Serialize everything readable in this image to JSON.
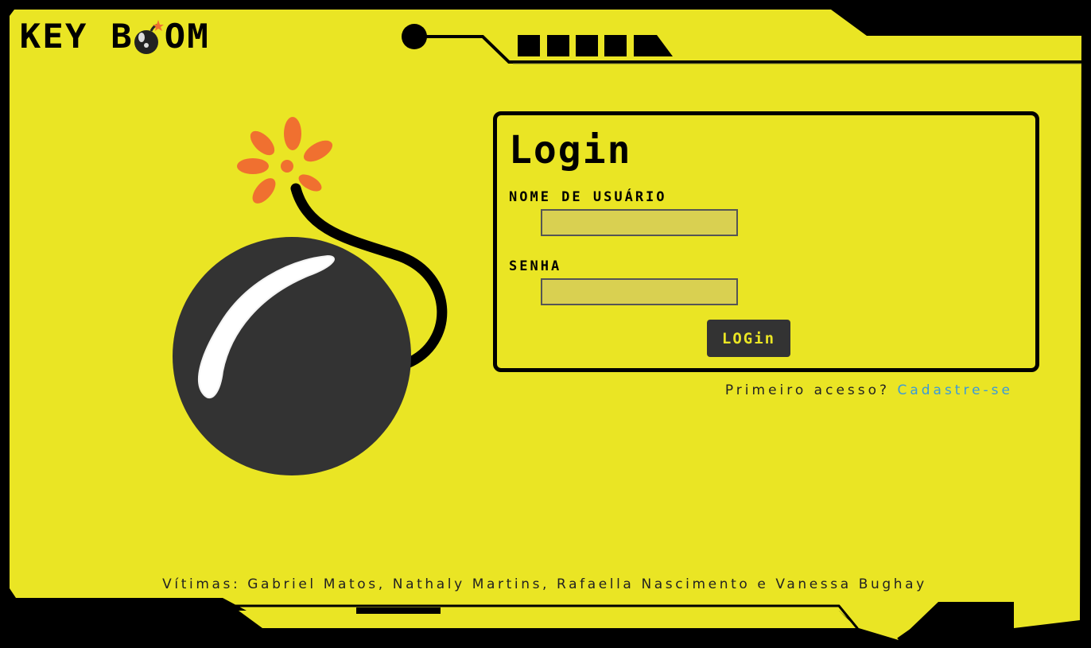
{
  "colors": {
    "panel": "#eae524",
    "frame": "#000000",
    "input_bg": "#d9d051",
    "button_bg": "#333333",
    "button_text": "#eae524",
    "bomb_body": "#333333",
    "spark": "#f07030",
    "link": "#3a9ad9"
  },
  "header": {
    "logo_part1": "KEY B",
    "logo_part2": "OM"
  },
  "login": {
    "title": "Login",
    "username_label": "Nome de usuário",
    "username_value": "",
    "password_label": "Senha",
    "password_value": "",
    "submit_label": "LOGin"
  },
  "signup": {
    "prompt": "Primeiro acesso? ",
    "link_label": "Cadastre-se"
  },
  "footer": {
    "credits": "Vítimas: Gabriel Matos, Nathaly Martins, Rafaella Nascimento e Vanessa Bughay"
  },
  "icons": {
    "logo_bomb": "bomb-icon",
    "hero": "bomb-illustration-icon"
  }
}
